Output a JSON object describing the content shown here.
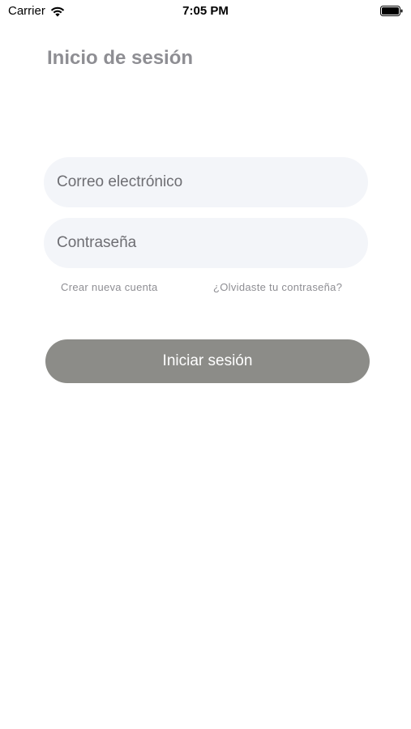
{
  "status_bar": {
    "carrier": "Carrier",
    "time": "7:05 PM",
    "wifi_icon": "wifi-icon",
    "battery_icon": "battery-full-icon"
  },
  "title": "Inicio de sesión",
  "form": {
    "email_placeholder": "Correo electrónico",
    "email_value": "",
    "password_placeholder": "Contraseña",
    "password_value": ""
  },
  "links": {
    "create_account": "Crear nueva cuenta",
    "forgot_password": "¿Olvidaste tu contraseña?"
  },
  "login_button": "Iniciar sesión",
  "colors": {
    "title": "#8e8e93",
    "field_bg": "#f3f5f9",
    "button_bg": "#8c8c88",
    "link": "#8e8e93"
  }
}
